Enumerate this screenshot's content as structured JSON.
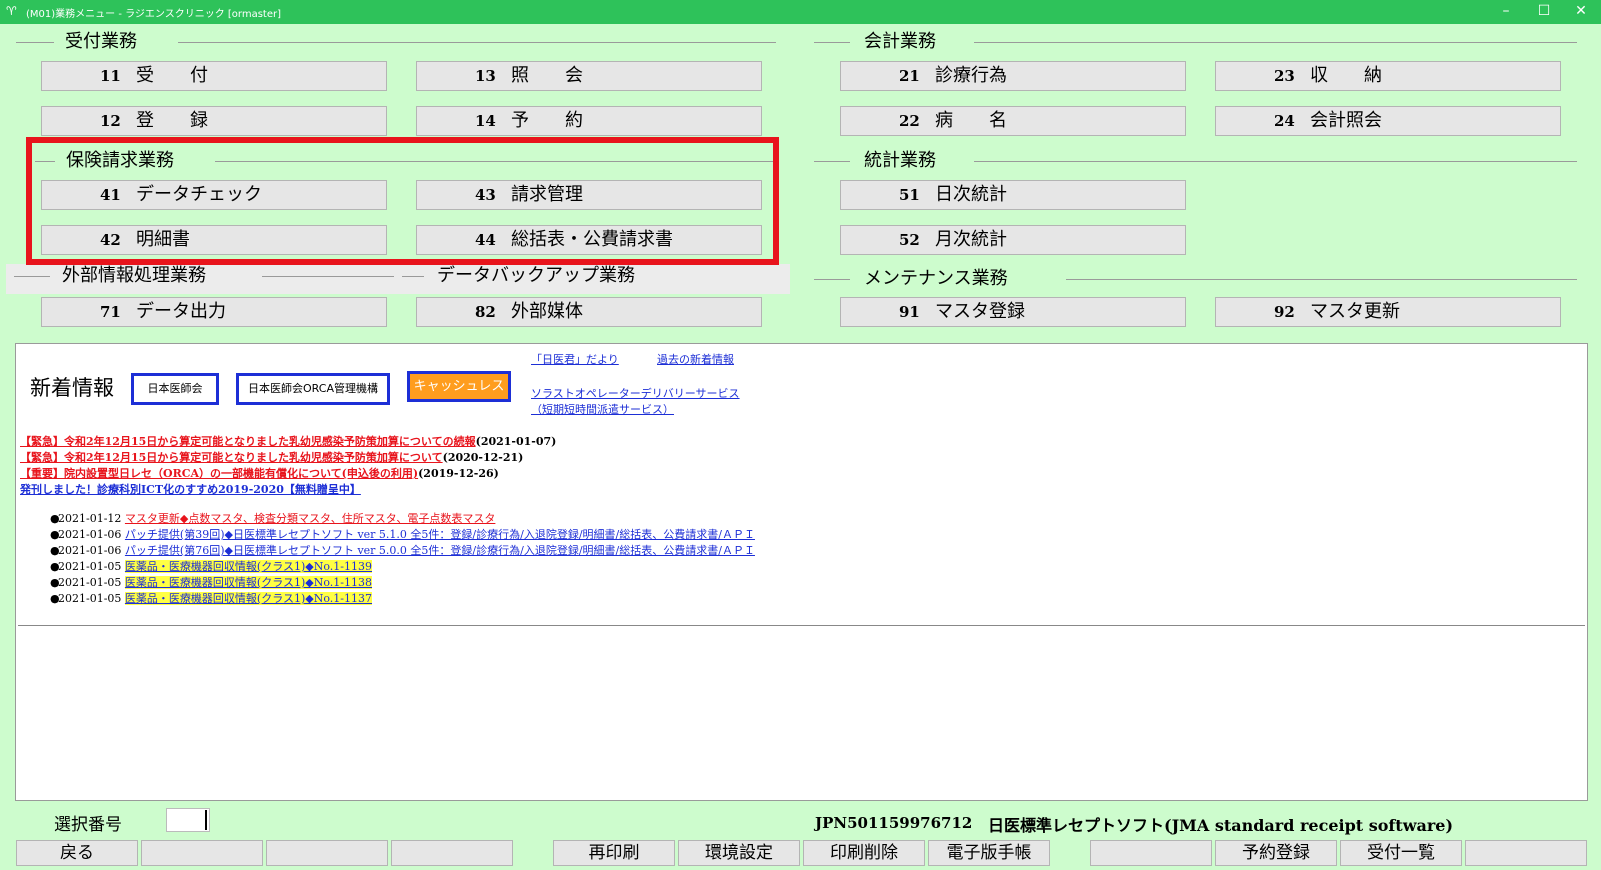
{
  "window": {
    "title": "(M01)業務メニュー - ラジエンスクリニック [ormaster]",
    "app_icon": "app-icon",
    "controls": [
      "–",
      "☐",
      "✕"
    ]
  },
  "sections": {
    "uketsuke": "受付業務",
    "kaikei": "会計業務",
    "hoken": "保険請求業務",
    "toukei": "統計業務",
    "gaibu": "外部情報処理業務",
    "backup": "データバックアップ業務",
    "maintenance": "メンテナンス業務"
  },
  "menu": {
    "b11": {
      "num": "11",
      "label": "受　　付"
    },
    "b13": {
      "num": "13",
      "label": "照　　会"
    },
    "b21": {
      "num": "21",
      "label": "診療行為"
    },
    "b23": {
      "num": "23",
      "label": "収　　納"
    },
    "b12": {
      "num": "12",
      "label": "登　　録"
    },
    "b14": {
      "num": "14",
      "label": "予　　約"
    },
    "b22": {
      "num": "22",
      "label": "病　　名"
    },
    "b24": {
      "num": "24",
      "label": "会計照会"
    },
    "b41": {
      "num": "41",
      "label": "データチェック"
    },
    "b43": {
      "num": "43",
      "label": "請求管理"
    },
    "b51": {
      "num": "51",
      "label": "日次統計"
    },
    "b42": {
      "num": "42",
      "label": "明細書"
    },
    "b44": {
      "num": "44",
      "label": "総括表・公費請求書"
    },
    "b52": {
      "num": "52",
      "label": "月次統計"
    },
    "b71": {
      "num": "71",
      "label": "データ出力"
    },
    "b82": {
      "num": "82",
      "label": "外部媒体"
    },
    "b91": {
      "num": "91",
      "label": "マスタ登録"
    },
    "b92": {
      "num": "92",
      "label": "マスタ更新"
    }
  },
  "news": {
    "heading": "新着情報",
    "buttons": {
      "jma": "日本医師会",
      "orca": "日本医師会ORCA管理機構",
      "cashless": "キャッシュレス"
    },
    "links": {
      "dayori": "「日医君」だより",
      "past": "過去の新着情報",
      "solarst1": "ソラストオペレーターデリバリーサービス",
      "solarst2": "（短期短時間派遣サービス）"
    },
    "urgent": [
      {
        "text": "【緊急】令和2年12月15日から算定可能となりました乳幼児感染予防策加算についての続報",
        "date": "(2021-01-07)",
        "color": "#e8141c"
      },
      {
        "text": "【緊急】令和2年12月15日から算定可能となりました乳幼児感染予防策加算について",
        "date": "(2020-12-21)",
        "color": "#e8141c"
      },
      {
        "text": "【重要】院内設置型日レセ（ORCA）の一部機能有償化について(申込後の利用)",
        "date": "(2019-12-26)",
        "color": "#e8141c"
      },
      {
        "text": "発刊しました！診療科別ICT化のすすめ2019-2020【無料贈呈中】",
        "date": "",
        "color": "#1d2fd6"
      }
    ],
    "updates": [
      {
        "bullet": "●",
        "date": "2021-01-12",
        "text": "マスタ更新◆点数マスタ、検査分類マスタ、住所マスタ、電子点数表マスタ",
        "style": "red"
      },
      {
        "bullet": "●",
        "date": "2021-01-06",
        "text": "パッチ提供(第39回)◆日医標準レセプトソフト ver 5.1.0 全5件：登録/診療行為/入退院登録/明細書/総括表、公費請求書/ＡＰＩ",
        "style": "blue"
      },
      {
        "bullet": "●",
        "date": "2021-01-06",
        "text": "パッチ提供(第76回)◆日医標準レセプトソフト ver 5.0.0 全5件：登録/診療行為/入退院登録/明細書/総括表、公費請求書/ＡＰＩ",
        "style": "blue"
      },
      {
        "bullet": "●",
        "date": "2021-01-05",
        "text": "医薬品・医療機器回収情報(クラス1)◆No.1-1139",
        "style": "hl"
      },
      {
        "bullet": "●",
        "date": "2021-01-05",
        "text": "医薬品・医療機器回収情報(クラス1)◆No.1-1138",
        "style": "hl"
      },
      {
        "bullet": "●",
        "date": "2021-01-05",
        "text": "医薬品・医療機器回収情報(クラス1)◆No.1-1137",
        "style": "hl"
      }
    ]
  },
  "bottom": {
    "select_label": "選択番号",
    "select_value": "",
    "jpn": "JPN501159976712",
    "software": "日医標準レセプトソフト(JMA standard receipt software)",
    "fkeys": [
      "戻る",
      "",
      "",
      "",
      "再印刷",
      "環境設定",
      "印刷削除",
      "電子版手帳",
      "",
      "予約登録",
      "受付一覧",
      ""
    ]
  }
}
